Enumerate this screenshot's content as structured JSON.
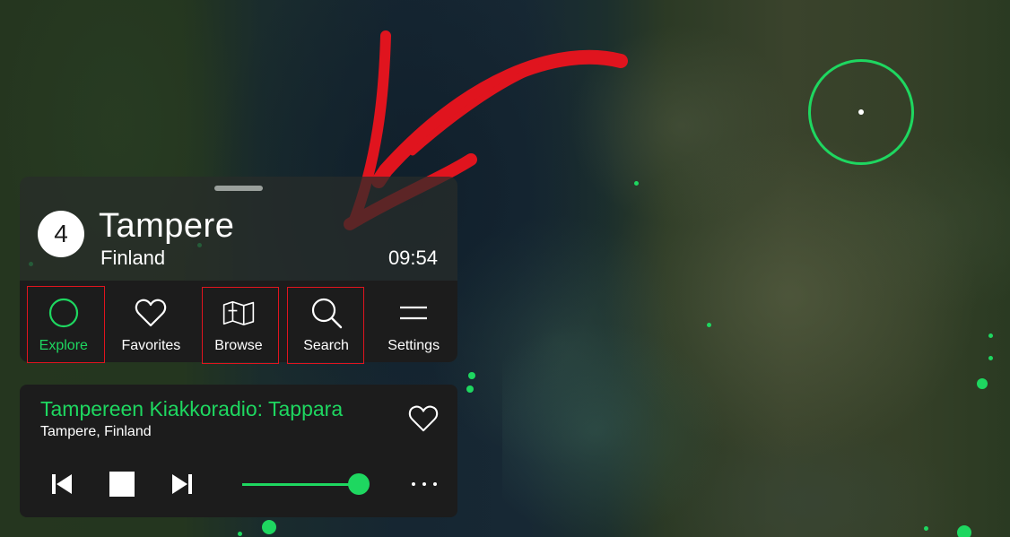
{
  "map": {
    "accent_color": "#1ed760"
  },
  "station": {
    "count": "4",
    "place": "Tampere",
    "country": "Finland",
    "time": "09:54"
  },
  "tabs": [
    {
      "label": "Explore",
      "icon": "explore-circle-icon",
      "active": true,
      "highlighted": true
    },
    {
      "label": "Favorites",
      "icon": "heart-icon",
      "active": false,
      "highlighted": false
    },
    {
      "label": "Browse",
      "icon": "map-icon",
      "active": false,
      "highlighted": true
    },
    {
      "label": "Search",
      "icon": "search-icon",
      "active": false,
      "highlighted": true
    },
    {
      "label": "Settings",
      "icon": "menu-icon",
      "active": false,
      "highlighted": false
    }
  ],
  "player": {
    "title": "Tampereen Kiakkoradio: Tappara",
    "subtitle": "Tampere, Finland",
    "volume": 1.0
  },
  "annotation": {
    "arrow_color": "#e0141e",
    "highlight_color": "#e0141e"
  }
}
